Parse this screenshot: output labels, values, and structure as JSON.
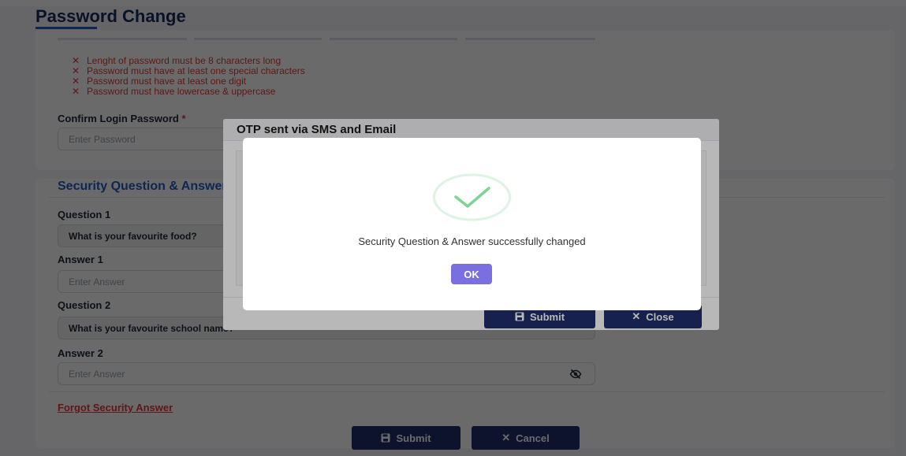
{
  "page": {
    "title": "Password Change",
    "password_rules": [
      {
        "icon": "close-icon",
        "text": "Lenght of password must be 8 characters long"
      },
      {
        "icon": "close-icon",
        "text": "Password must have at least one special characters"
      },
      {
        "icon": "close-icon",
        "text": "Password must have at least one digit"
      },
      {
        "icon": "close-icon",
        "text": "Password must have lowercase & uppercase"
      }
    ],
    "confirm_password": {
      "label": "Confirm Login Password",
      "required_mark": "*",
      "placeholder": "Enter Password"
    },
    "security_section": {
      "title": "Security Question & Answer",
      "question1": {
        "label": "Question 1",
        "value": "What is your favourite food?"
      },
      "answer1": {
        "label": "Answer 1",
        "placeholder": "Enter Answer"
      },
      "question2": {
        "label": "Question 2",
        "value": "What is your favourite school name?"
      },
      "answer2": {
        "label": "Answer 2",
        "placeholder": "Enter Answer",
        "toggle_icon": "eye-slash-icon"
      },
      "forgot_link": "Forgot Security Answer",
      "submit_label": "Submit",
      "cancel_label": "Cancel"
    }
  },
  "otp_modal": {
    "title": "OTP sent via SMS and Email",
    "submit_label": "Submit",
    "close_label": "Close"
  },
  "success_dialog": {
    "icon": "check-icon",
    "message": "Security Question & Answer successfully changed",
    "ok_label": "OK"
  },
  "colors": {
    "primary_button": "#1f2f6b",
    "ok_button": "#7a6fe0",
    "error_text": "#e53935",
    "section_title": "#1f5fc4",
    "success_check": "#7ed492"
  }
}
